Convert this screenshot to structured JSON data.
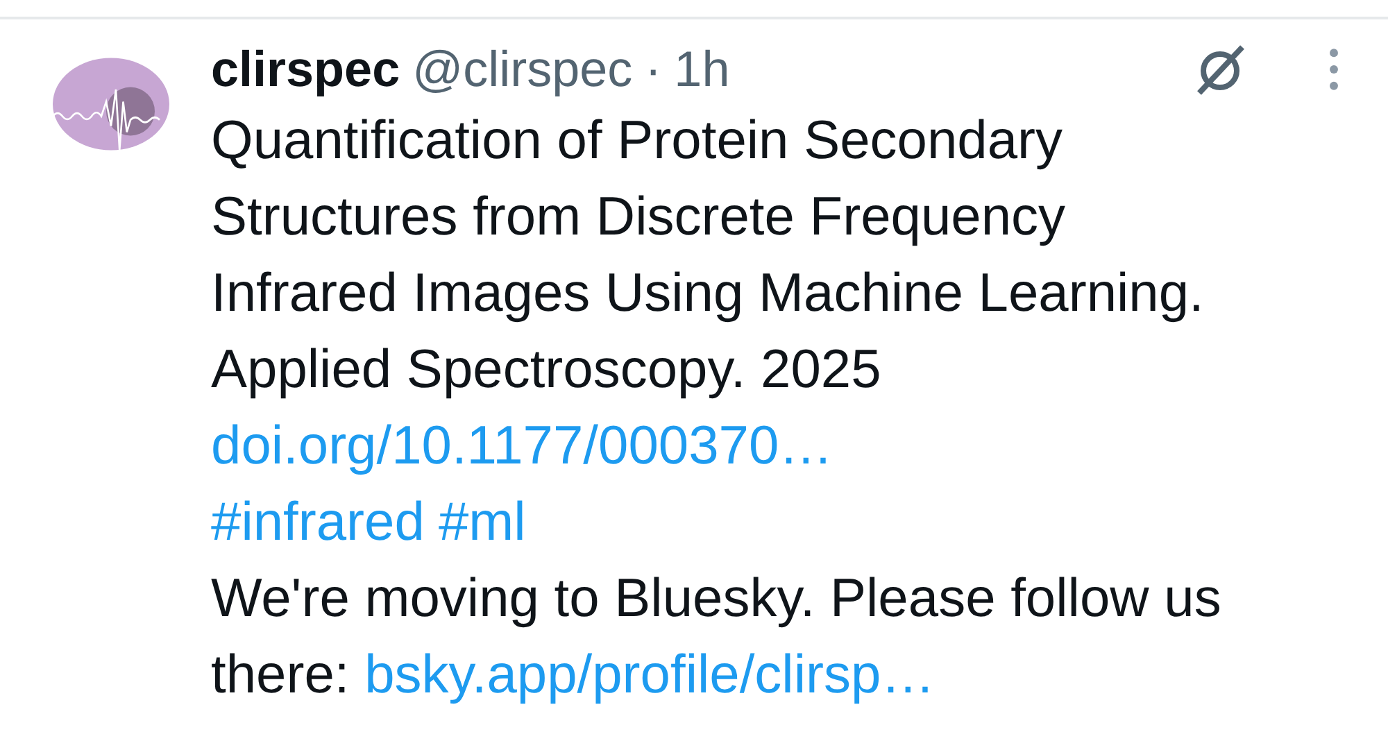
{
  "post": {
    "author": {
      "name": "clirspec",
      "handle": "@clirspec",
      "separator": "·",
      "time": "1h"
    },
    "paragraphs": [
      [
        {
          "kind": "text",
          "text": "Quantification of Protein Secondary Structures from Discrete Frequency Infrared Images Using Machine Learning. Applied Spectroscopy. 2025 "
        },
        {
          "kind": "link",
          "text": "doi.org/10.1177/000370…"
        }
      ],
      [
        {
          "kind": "hashtag",
          "text": "#infrared"
        },
        {
          "kind": "hashtag",
          "text": "#ml"
        }
      ],
      [
        {
          "kind": "text",
          "text": "We're moving to Bluesky. Please follow us there: "
        },
        {
          "kind": "link",
          "text": "bsky.app/profile/clirsp…"
        }
      ]
    ]
  }
}
